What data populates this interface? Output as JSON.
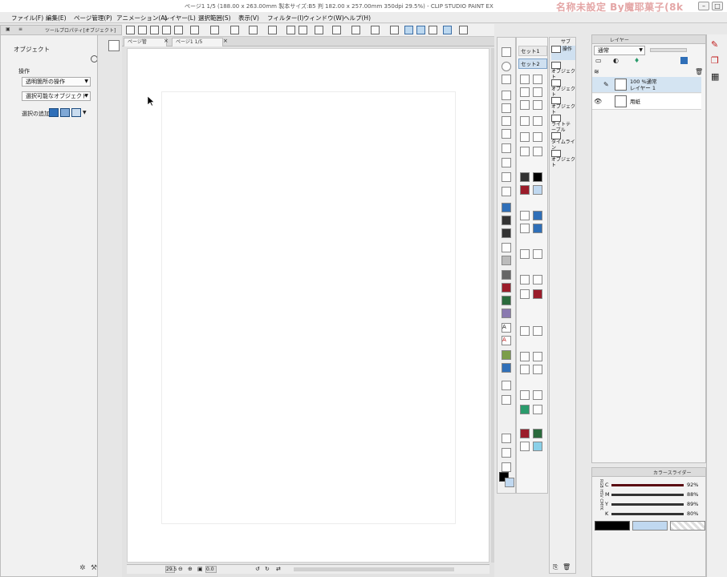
{
  "window": {
    "title": "ページ1 1/5 (188.00 x 263.00mm 製本サイズ:B5 判 182.00 x 257.00mm 350dpi 29.5%) - CLIP STUDIO PAINT EX",
    "watermark": "名称未設定 By魔耶菓子(8k"
  },
  "menu": [
    "ファイル(F)",
    "編集(E)",
    "ページ管理(P)",
    "アニメーション(A)",
    "レイヤー(L)",
    "選択範囲(S)",
    "表示(V)",
    "フィルター(I)",
    "ウィンドウ(W)",
    "ヘルプ(H)"
  ],
  "left_panel": {
    "tab_label": "ツールプロパティ[オブジェクト]",
    "title": "オブジェクト",
    "section": "操作",
    "dropdown1": "透明箇所の操作",
    "dropdown2": "選択可能なオブジェクト",
    "option_label": "選択の追加"
  },
  "doc_tabs": {
    "tab1": "ページ管",
    "tab2": "ページ1",
    "page_count": "1/5"
  },
  "status": {
    "zoom": "29.5",
    "angle": "0.0"
  },
  "sub_tool_groups": [
    {
      "label": "セット1",
      "active": false
    },
    {
      "label": "セット2",
      "active": true
    }
  ],
  "sub_tools": {
    "header": "サブ",
    "items": [
      "操作",
      "オブジェクト",
      "オブジェクト",
      "オブジェクト",
      "ライトテーブル",
      "タイムライン",
      "オブジェクト"
    ]
  },
  "layer_panel": {
    "tab_label": "レイヤー",
    "blend_mode": "通常",
    "layers": [
      {
        "opacity_mode": "100 %通常",
        "name": "レイヤー 1",
        "selected": true
      },
      {
        "opacity_mode": "",
        "name": "用紙",
        "selected": false
      }
    ]
  },
  "color_panel": {
    "tab_label": "カラースライダー",
    "side_tabs": [
      "RGB",
      "HSV",
      "CMYK"
    ],
    "sliders": [
      {
        "label": "C",
        "value": "92%",
        "color": "#5a0a12"
      },
      {
        "label": "M",
        "value": "88%",
        "color": "#222222"
      },
      {
        "label": "Y",
        "value": "89%",
        "color": "#222222"
      },
      {
        "label": "K",
        "value": "80%",
        "color": "#222222"
      }
    ],
    "main_color": "#000000",
    "sub_color": "#c0d8f0"
  },
  "colors": {
    "accent": "#3c6ea5",
    "selection": "#d4e4f2"
  }
}
